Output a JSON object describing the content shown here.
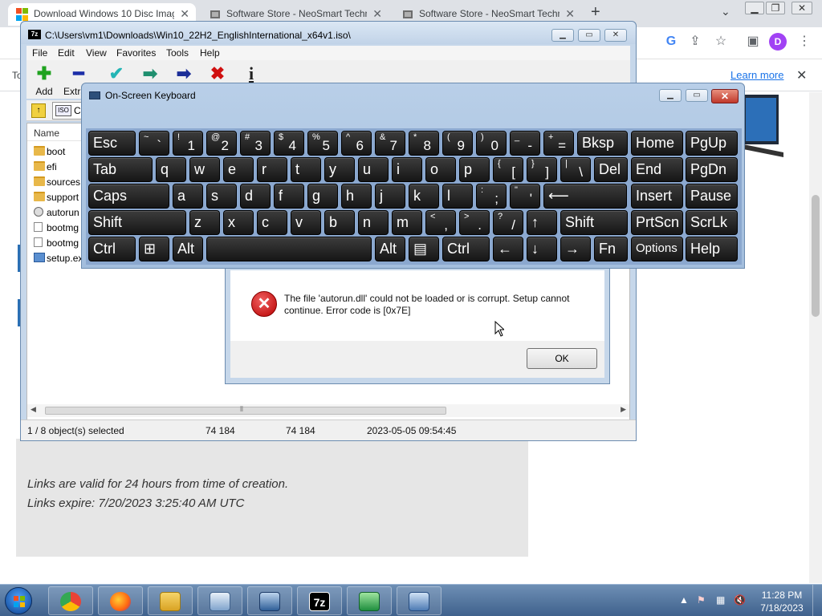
{
  "browser": {
    "tabs": [
      {
        "title": "Download Windows 10 Disc Image",
        "active": true
      },
      {
        "title": "Software Store - NeoSmart Technologies",
        "active": false
      },
      {
        "title": "Software Store - NeoSmart Technologies",
        "active": false
      }
    ],
    "new_tab_glyph": "+",
    "infobar": {
      "lead_text": "To",
      "link": "Learn more"
    },
    "avatar_letter": "D"
  },
  "webpage": {
    "links_valid": "Links are valid for 24 hours from time of creation.",
    "links_expire": "Links expire: 7/20/2023 3:25:40 AM UTC"
  },
  "sevenzip": {
    "title": "C:\\Users\\vm1\\Downloads\\Win10_22H2_EnglishInternational_x64v1.iso\\",
    "icon_text": "7z",
    "menu": [
      "File",
      "Edit",
      "View",
      "Favorites",
      "Tools",
      "Help"
    ],
    "toolbar": [
      {
        "label": "Add",
        "glyph": "✚",
        "color": "#1fa21f"
      },
      {
        "label": "Extract",
        "glyph": "━",
        "color": "#1c2ea8"
      },
      {
        "label": "",
        "glyph": "✔",
        "color": "#23b5b5"
      },
      {
        "label": "",
        "glyph": "➡",
        "color": "#1f8f6f"
      },
      {
        "label": "",
        "glyph": "➡",
        "color": "#1c2e98"
      },
      {
        "label": "",
        "glyph": "✖",
        "color": "#d01010"
      },
      {
        "label": "",
        "glyph": "i",
        "color": "#202020"
      }
    ],
    "address_partial": "C:",
    "iso_label": "ISO",
    "column_name": "Name",
    "files": [
      {
        "name": "boot",
        "kind": "folder"
      },
      {
        "name": "efi",
        "kind": "folder"
      },
      {
        "name": "sources",
        "kind": "folder"
      },
      {
        "name": "support",
        "kind": "folder"
      },
      {
        "name": "autorun",
        "kind": "gear"
      },
      {
        "name": "bootmg",
        "kind": "file"
      },
      {
        "name": "bootmg",
        "kind": "file"
      },
      {
        "name": "setup.ex",
        "kind": "exe"
      }
    ],
    "status": {
      "selected": "1 / 8 object(s) selected",
      "size": "74 184",
      "packed": "74 184",
      "modified": "2023-05-05 09:54:45"
    }
  },
  "error_dialog": {
    "message": "The file 'autorun.dll' could not be loaded or is corrupt. Setup cannot continue. Error code is [0x7E]",
    "ok_label": "OK",
    "icon": "error-x-icon"
  },
  "osk": {
    "title": "On-Screen Keyboard",
    "rows": [
      [
        {
          "label": "Esc"
        },
        {
          "top": "~",
          "bot": "`"
        },
        {
          "top": "!",
          "bot": "1"
        },
        {
          "top": "@",
          "bot": "2"
        },
        {
          "top": "#",
          "bot": "3"
        },
        {
          "top": "$",
          "bot": "4"
        },
        {
          "top": "%",
          "bot": "5"
        },
        {
          "top": "^",
          "bot": "6"
        },
        {
          "top": "&",
          "bot": "7"
        },
        {
          "top": "*",
          "bot": "8"
        },
        {
          "top": "(",
          "bot": "9"
        },
        {
          "top": ")",
          "bot": "0"
        },
        {
          "top": "_",
          "bot": "-"
        },
        {
          "top": "+",
          "bot": "="
        },
        {
          "label": "Bksp"
        },
        {
          "label": "Home"
        },
        {
          "label": "PgUp"
        }
      ],
      [
        {
          "label": "Tab"
        },
        {
          "label": "q"
        },
        {
          "label": "w"
        },
        {
          "label": "e"
        },
        {
          "label": "r"
        },
        {
          "label": "t"
        },
        {
          "label": "y"
        },
        {
          "label": "u"
        },
        {
          "label": "i"
        },
        {
          "label": "o"
        },
        {
          "label": "p"
        },
        {
          "top": "{",
          "bot": "["
        },
        {
          "top": "}",
          "bot": "]"
        },
        {
          "top": "|",
          "bot": "\\"
        },
        {
          "label": "Del"
        },
        {
          "label": "End"
        },
        {
          "label": "PgDn"
        }
      ],
      [
        {
          "label": "Caps"
        },
        {
          "label": "a"
        },
        {
          "label": "s"
        },
        {
          "label": "d"
        },
        {
          "label": "f"
        },
        {
          "label": "g"
        },
        {
          "label": "h"
        },
        {
          "label": "j"
        },
        {
          "label": "k"
        },
        {
          "label": "l"
        },
        {
          "top": ":",
          "bot": ";"
        },
        {
          "top": "\"",
          "bot": "'"
        },
        {
          "label": "⟵"
        },
        {
          "label": "Insert"
        },
        {
          "label": "Pause"
        }
      ],
      [
        {
          "label": "Shift"
        },
        {
          "label": "z"
        },
        {
          "label": "x"
        },
        {
          "label": "c"
        },
        {
          "label": "v"
        },
        {
          "label": "b"
        },
        {
          "label": "n"
        },
        {
          "label": "m"
        },
        {
          "top": "<",
          "bot": ","
        },
        {
          "top": ">",
          "bot": "."
        },
        {
          "top": "?",
          "bot": "/"
        },
        {
          "label": "↑"
        },
        {
          "label": "Shift"
        },
        {
          "label": "PrtScn"
        },
        {
          "label": "ScrLk"
        }
      ],
      [
        {
          "label": "Ctrl"
        },
        {
          "label": "⊞"
        },
        {
          "label": "Alt"
        },
        {
          "label": ""
        },
        {
          "label": "Alt"
        },
        {
          "label": "▤"
        },
        {
          "label": "Ctrl"
        },
        {
          "label": "←"
        },
        {
          "label": "↓"
        },
        {
          "label": "→"
        },
        {
          "label": "Fn"
        },
        {
          "label": "Options"
        },
        {
          "label": "Help"
        }
      ]
    ]
  },
  "taskbar": {
    "apps": [
      "chrome",
      "firefox",
      "file-explorer",
      "control-panel",
      "computer",
      "7-zip",
      "installer",
      "on-screen-keyboard"
    ],
    "time": "11:28 PM",
    "date": "7/18/2023"
  }
}
